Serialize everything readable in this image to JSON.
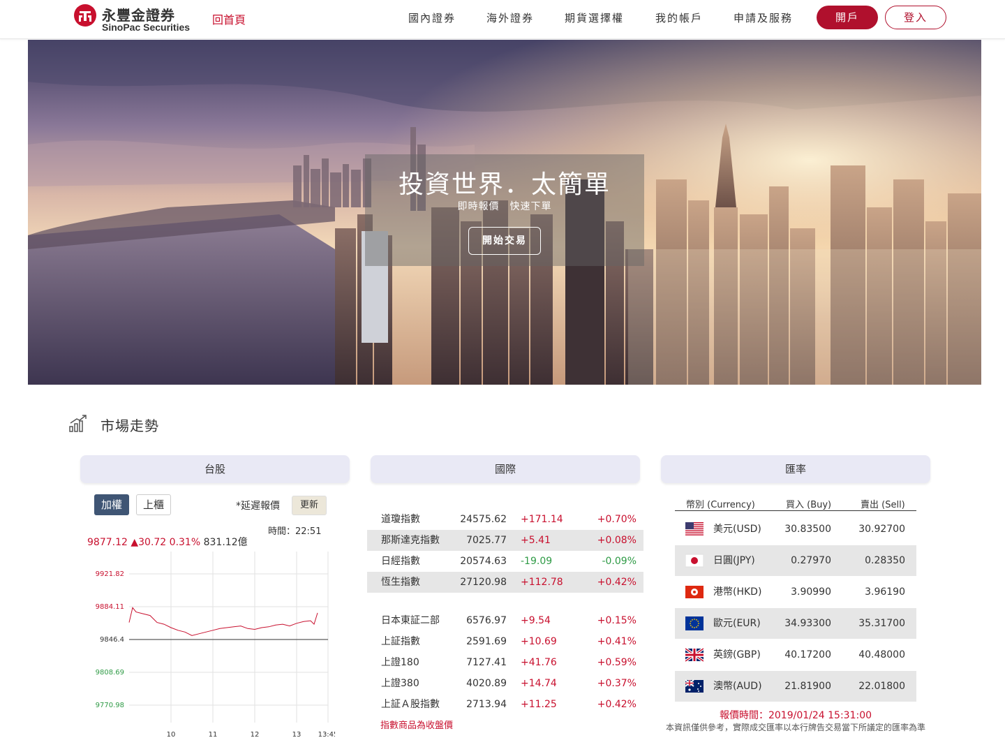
{
  "header": {
    "logo_cn": "永豐金證券",
    "logo_en": "SinoPac Securities",
    "home_link": "回首頁",
    "nav": [
      "國內證券",
      "海外證券",
      "期貨選擇權",
      "我的帳戶",
      "申請及服務"
    ],
    "open_account": "開戶",
    "login": "登入"
  },
  "hero": {
    "title": "投資世界．太簡單",
    "subtitle": "即時報價　快速下單",
    "cta": "開始交易"
  },
  "market": {
    "title": "市場走勢",
    "panels": [
      "台股",
      "國際",
      "匯率"
    ]
  },
  "tw": {
    "tabs": [
      "加權",
      "上櫃"
    ],
    "delay_label": "*延遲報價",
    "refresh": "更新",
    "time": "時間：22:51",
    "index": "9877.12",
    "change": "▲30.72",
    "pct": "0.31%",
    "volume": "831.12億"
  },
  "intl": {
    "rows": [
      {
        "name": "道瓊指數",
        "value": "24575.62",
        "change": "+171.14",
        "pct": "+0.70%"
      },
      {
        "name": "那斯達克指數",
        "value": "7025.77",
        "change": "+5.41",
        "pct": "+0.08%"
      },
      {
        "name": "日經指數",
        "value": "20574.63",
        "change": "-19.09",
        "pct": "-0.09%"
      },
      {
        "name": "恆生指數",
        "value": "27120.98",
        "change": "+112.78",
        "pct": "+0.42%"
      },
      {
        "name": "日本東証二部",
        "value": "6576.97",
        "change": "+9.54",
        "pct": "+0.15%"
      },
      {
        "name": "上証指數",
        "value": "2591.69",
        "change": "+10.69",
        "pct": "+0.41%"
      },
      {
        "name": "上證180",
        "value": "7127.41",
        "change": "+41.76",
        "pct": "+0.59%"
      },
      {
        "name": "上證380",
        "value": "4020.89",
        "change": "+14.74",
        "pct": "+0.37%"
      },
      {
        "name": "上証Ａ股指數",
        "value": "2713.94",
        "change": "+11.25",
        "pct": "+0.42%"
      }
    ],
    "note": "指數商品為收盤價"
  },
  "fx": {
    "headers": [
      "幣別 (Currency)",
      "買入 (Buy)",
      "賣出 (Sell)"
    ],
    "rows": [
      {
        "name": "美元(USD)",
        "buy": "30.83500",
        "sell": "30.92700",
        "flag": "us-flag-icon"
      },
      {
        "name": "日圓(JPY)",
        "buy": "0.27970",
        "sell": "0.28350",
        "flag": "jp-flag-icon"
      },
      {
        "name": "港幣(HKD)",
        "buy": "3.90990",
        "sell": "3.96190",
        "flag": "hk-flag-icon"
      },
      {
        "name": "歐元(EUR)",
        "buy": "34.93300",
        "sell": "35.31700",
        "flag": "eu-flag-icon"
      },
      {
        "name": "英鎊(GBP)",
        "buy": "40.17200",
        "sell": "40.48000",
        "flag": "gb-flag-icon"
      },
      {
        "name": "澳幣(AUD)",
        "buy": "21.81900",
        "sell": "22.01800",
        "flag": "au-flag-icon"
      }
    ],
    "time": "報價時間：2019/01/24 15:31:00",
    "note": "本資訊僅供參考，實際成交匯率以本行牌告交易當下所議定的匯率為準"
  },
  "chart_data": {
    "type": "line",
    "title": "",
    "y_ticks": [
      "9921.82",
      "9884.11",
      "9846.4",
      "9808.69",
      "9770.98"
    ],
    "y_reference": 9846.4,
    "ylim": [
      9770.98,
      9921.82
    ],
    "x_ticks": [
      "10",
      "11",
      "12",
      "13",
      "13:45"
    ],
    "series": [
      {
        "x": [
          "09:00",
          "09:05",
          "09:10",
          "09:20",
          "09:30",
          "09:40",
          "09:50",
          "10:00",
          "10:10",
          "10:20",
          "10:30",
          "10:40",
          "10:50",
          "11:00",
          "11:10",
          "11:20",
          "11:30",
          "11:40",
          "11:50",
          "12:00",
          "12:10",
          "12:20",
          "12:30",
          "12:40",
          "12:50",
          "13:00",
          "13:10",
          "13:20",
          "13:25",
          "13:30"
        ],
        "values": [
          9866,
          9883,
          9878,
          9876,
          9874,
          9866,
          9864,
          9860,
          9857,
          9855,
          9851,
          9853,
          9855,
          9857,
          9859,
          9860,
          9861,
          9862,
          9859,
          9858,
          9860,
          9861,
          9863,
          9864,
          9862,
          9865,
          9867,
          9868,
          9864,
          9877
        ]
      }
    ],
    "grid": true,
    "colors": {
      "line": "#c8102e",
      "up_tick": "#c8102e",
      "down_tick": "#2e9a45"
    }
  }
}
